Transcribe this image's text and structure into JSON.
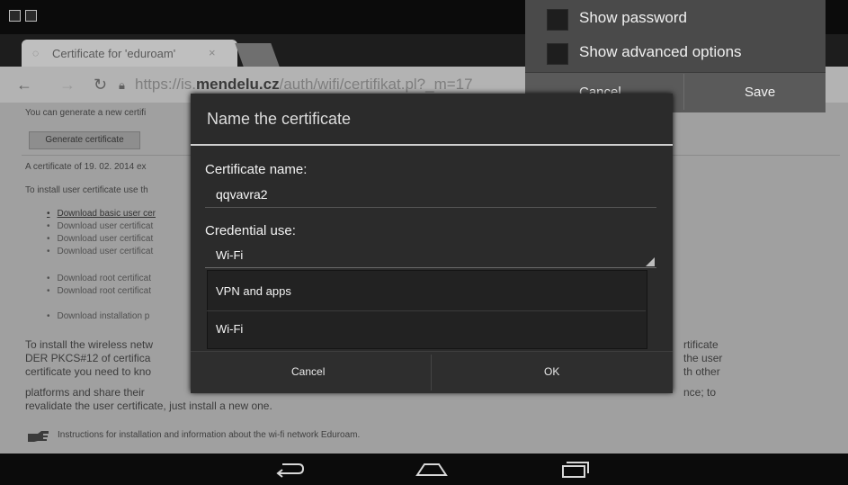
{
  "status_bar": {
    "icons": [
      "notification-icon",
      "image-icon"
    ]
  },
  "browser": {
    "tab_title": "Certificate for 'eduroam'",
    "tab_close": "×",
    "url_prefix": "https://is.",
    "url_host": "mendelu.cz",
    "url_path": "/auth/wifi/certifikat.pl?_m=17"
  },
  "page": {
    "line1": "You can generate a new certifi",
    "generate_button": "Generate certificate",
    "line2": "A certificate of 19. 02. 2014 ex",
    "line3": "To install user certificate use th",
    "bullets": [
      "Download basic user cer",
      "Download user certificat",
      "Download user certificat",
      "Download user certificat",
      "Download root certificat",
      "Download root certificat",
      "Download installation p"
    ],
    "para_left": [
      "To install the wireless netw",
      "DER PKCS#12 of certifica",
      "certificate you need to kno",
      "platforms and share their",
      "revalidate the user certificate, just install a new one."
    ],
    "para_right": [
      "rtificate",
      "the user",
      "th other",
      "nce; to"
    ],
    "para_mid_tail": "",
    "footer_link": "Instructions for installation and information about the wi-fi network Eduroam."
  },
  "popup": {
    "show_password": "Show password",
    "show_advanced": "Show advanced options",
    "cancel": "Cancel",
    "save": "Save"
  },
  "dialog": {
    "title": "Name the certificate",
    "cert_name_label": "Certificate name:",
    "cert_name_value": "qqvavra2",
    "credential_label": "Credential use:",
    "credential_value": "Wi-Fi",
    "options": [
      "VPN and apps",
      "Wi-Fi"
    ],
    "cancel": "Cancel",
    "ok": "OK"
  },
  "navbar": {
    "back": "⮌",
    "home": "⌂",
    "recents": "▭"
  }
}
